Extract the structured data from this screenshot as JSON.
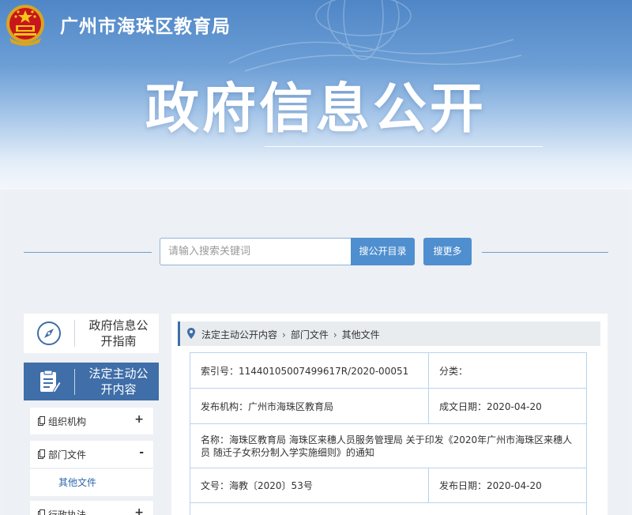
{
  "header": {
    "site_title": "广州市海珠区教育局",
    "big_title": "政府信息公开"
  },
  "search": {
    "placeholder": "请输入搜索关键词",
    "catalog_button": "搜公开目录",
    "more_button": "搜更多"
  },
  "sidebar": {
    "guide_label": "政府信息公开指南",
    "active_label": "法定主动公开内容",
    "items": [
      {
        "label": "组织机构",
        "sign": "+"
      },
      {
        "label": "部门文件",
        "sign": "-"
      },
      {
        "label": "行政执法",
        "sign": "+"
      }
    ],
    "sub_items": [
      "其他文件"
    ]
  },
  "breadcrumb": [
    "法定主动公开内容",
    "部门文件",
    "其他文件"
  ],
  "document": {
    "index_label": "索引号：",
    "index_value": "11440105007499617R/2020-00051",
    "category_label": "分类：",
    "category_value": "",
    "issuer_label": "发布机构：",
    "issuer_value": "广州市海珠区教育局",
    "created_label": "成文日期：",
    "created_value": "2020-04-20",
    "name_label": "名称：",
    "name_value": "海珠区教育局 海珠区来穗人员服务管理局 关于印发《2020年广州市海珠区来穗人员 随迁子女积分制入学实施细则》的通知",
    "doc_no_label": "文号：",
    "doc_no_value": "海教〔2020〕53号",
    "publish_label": "发布日期：",
    "publish_value": "2020-04-20"
  },
  "colors": {
    "accent": "#3f6ea8",
    "button": "#4f8fcf",
    "table_border": "#b9d3ec"
  }
}
